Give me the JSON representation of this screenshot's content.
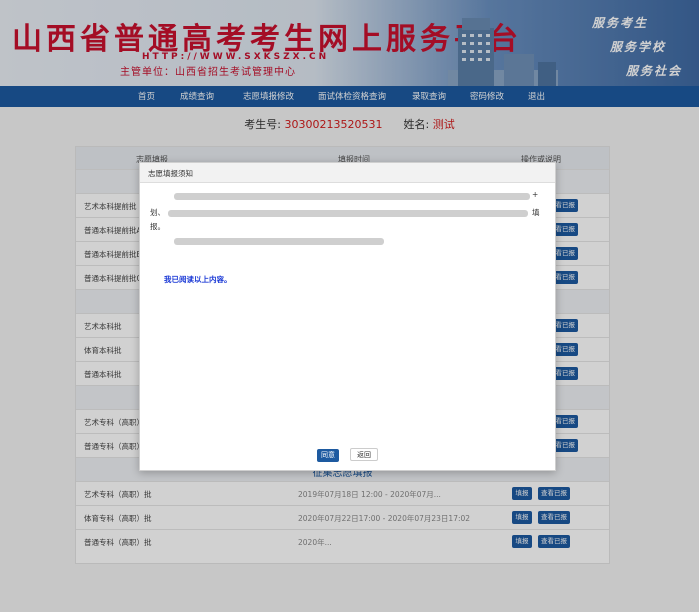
{
  "header": {
    "title": "山西省普通高考考生网上服务平台",
    "url": "HTTP://WWW.SXKSZX.CN",
    "org": "主管单位：山西省招生考试管理中心",
    "slogans": [
      "服务考生",
      "服务学校",
      "服务社会"
    ]
  },
  "nav": [
    "首页",
    "成绩查询",
    "志愿填报修改",
    "面试体检资格查询",
    "录取查询",
    "密码修改",
    "退出"
  ],
  "student": {
    "id_label": "考生号:",
    "id_value": "30300213520531",
    "name_label": "姓名:",
    "name_value": "测试"
  },
  "table": {
    "headers": [
      "志愿填报",
      "填报时间",
      "操作或说明"
    ],
    "rows_first": [
      {
        "label": "艺术本科提前批"
      },
      {
        "label": "普通本科提前批A"
      },
      {
        "label": "普通本科提前批B"
      },
      {
        "label": "普通本科提前批C"
      }
    ],
    "rows_second": [
      {
        "label": "艺术本科批"
      },
      {
        "label": "体育本科批"
      },
      {
        "label": "普通本科批"
      }
    ],
    "rows_third": [
      {
        "label": "艺术专科（高职）"
      },
      {
        "label": "普通专科（高职）"
      }
    ],
    "section_fourth": "征集志愿填报",
    "rows_fourth": [
      {
        "label": "艺术专科（高职）批",
        "time": "2019年07月18日 12:00 - 2020年07月..."
      },
      {
        "label": "体育专科（高职）批",
        "time": "2020年07月22日17:00 - 2020年07月23日17:02"
      },
      {
        "label": "普通专科（高职）批",
        "time": "2020年..."
      }
    ],
    "btn_fill": "填报",
    "btn_view": "查看已报"
  },
  "modal": {
    "title": "志愿填报须知",
    "text_dash": "划、",
    "text_report": "报。",
    "text_plus": "+",
    "text_fill": "填",
    "ack": "我已阅读以上内容。",
    "ok": "同意",
    "back": "返回"
  }
}
